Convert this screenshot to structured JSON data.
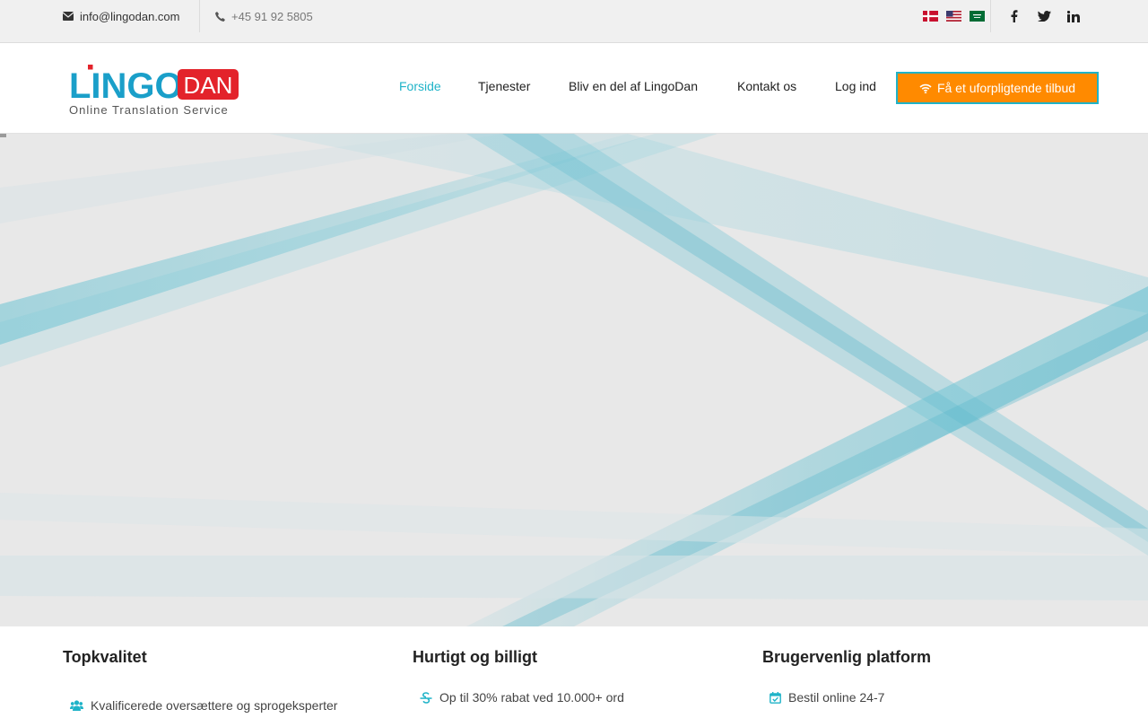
{
  "topbar": {
    "email": "info@lingodan.com",
    "phone": "+45 91 92 5805",
    "icons": {
      "email": "envelope-icon",
      "phone": "phone-icon"
    },
    "flags": [
      "danish-flag-icon",
      "us-flag-icon",
      "saudi-flag-icon"
    ],
    "social": [
      "facebook-icon",
      "twitter-icon",
      "linkedin-icon"
    ]
  },
  "logo": {
    "text_main": "LINGO",
    "text_box": "DAN",
    "tagline": "Online Translation Service"
  },
  "nav": {
    "items": [
      {
        "label": "Forside",
        "active": true
      },
      {
        "label": "Tjenester",
        "active": false
      },
      {
        "label": "Bliv en del af LingoDan",
        "active": false
      },
      {
        "label": "Kontakt os",
        "active": false
      },
      {
        "label": "Log ind",
        "active": false
      }
    ],
    "cta_label": "Få et uforpligtende tilbud",
    "cta_icon": "wifi-icon"
  },
  "features": [
    {
      "title": "Topkvalitet",
      "item": "Kvalificerede oversættere og sprogeksperter",
      "icon": "users-icon"
    },
    {
      "title": "Hurtigt og billigt",
      "item": "Op til 30% rabat ved 10.000+ ord",
      "icon": "strikethrough-icon"
    },
    {
      "title": "Brugervenlig platform",
      "item": "Bestil online 24-7",
      "icon": "calendar-check-icon"
    }
  ],
  "colors": {
    "accent": "#1fb3c8",
    "cta": "#ff8a00",
    "logo_blue": "#1a9fc9",
    "logo_red": "#e3232b"
  }
}
